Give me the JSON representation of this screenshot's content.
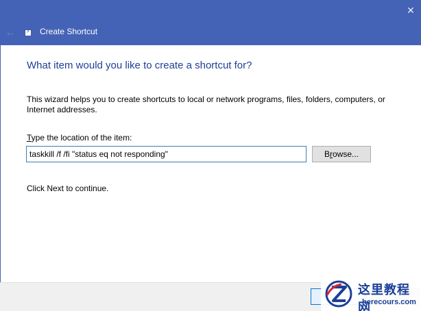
{
  "window": {
    "close_glyph": "✕",
    "title": "Create Shortcut",
    "back_glyph": "←",
    "app_icon": "shortcut-icon"
  },
  "wizard": {
    "heading": "What item would you like to create a shortcut for?",
    "description": "This wizard helps you to create shortcuts to local or network programs, files, folders, computers, or Internet addresses.",
    "location_label_accel": "T",
    "location_label_rest": "ype the location of the item:",
    "location_value": "taskkill /f /fi \"status eq not responding\"",
    "browse_accel_pre": "B",
    "browse_accel": "r",
    "browse_rest": "owse...",
    "continue_text": "Click Next to continue."
  },
  "watermark": {
    "text_cn": "这里教程网",
    "url": "herecours.com"
  },
  "colors": {
    "titlebar": "#4563b6",
    "heading": "#1d3f95",
    "input_border": "#3c7fb1",
    "watermark": "#1a3f96"
  }
}
